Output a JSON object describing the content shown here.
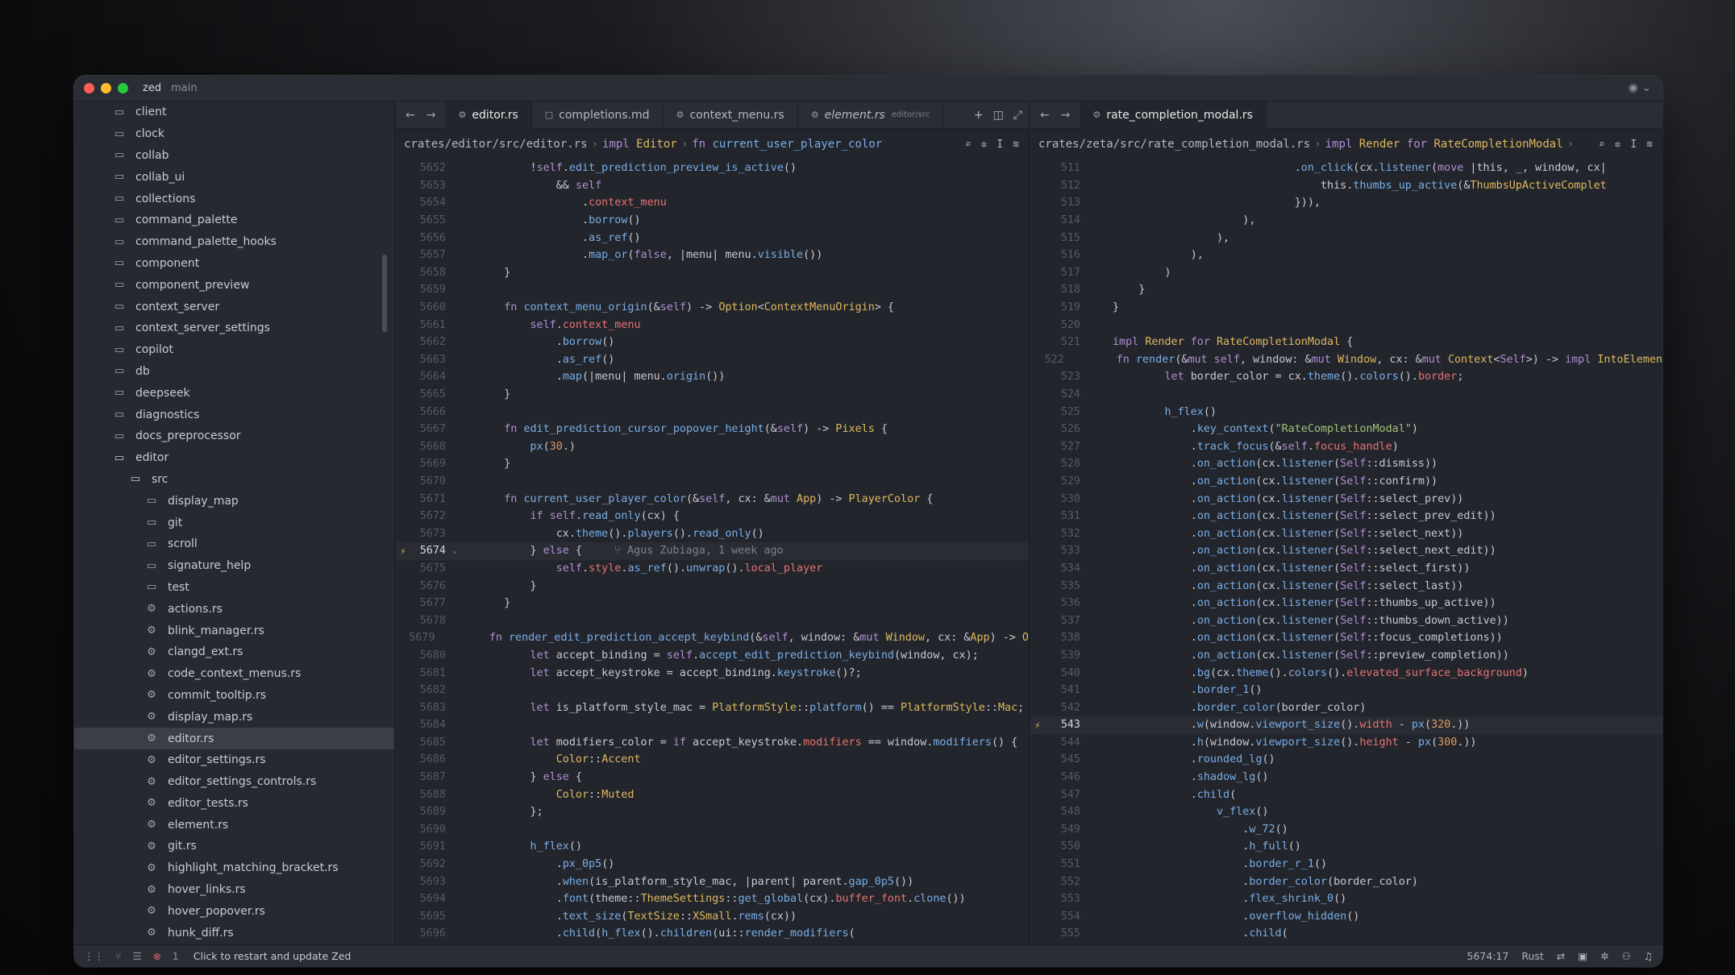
{
  "titlebar": {
    "app": "zed",
    "branch": "main"
  },
  "sidebar": {
    "items": [
      {
        "label": "client",
        "icon": "folder",
        "depth": 0
      },
      {
        "label": "clock",
        "icon": "folder",
        "depth": 0
      },
      {
        "label": "collab",
        "icon": "folder",
        "depth": 0
      },
      {
        "label": "collab_ui",
        "icon": "folder",
        "depth": 0
      },
      {
        "label": "collections",
        "icon": "folder",
        "depth": 0
      },
      {
        "label": "command_palette",
        "icon": "folder",
        "depth": 0
      },
      {
        "label": "command_palette_hooks",
        "icon": "folder",
        "depth": 0
      },
      {
        "label": "component",
        "icon": "folder",
        "depth": 0
      },
      {
        "label": "component_preview",
        "icon": "folder",
        "depth": 0
      },
      {
        "label": "context_server",
        "icon": "folder",
        "depth": 0
      },
      {
        "label": "context_server_settings",
        "icon": "folder",
        "depth": 0
      },
      {
        "label": "copilot",
        "icon": "folder",
        "depth": 0
      },
      {
        "label": "db",
        "icon": "folder",
        "depth": 0
      },
      {
        "label": "deepseek",
        "icon": "folder",
        "depth": 0
      },
      {
        "label": "diagnostics",
        "icon": "folder",
        "depth": 0
      },
      {
        "label": "docs_preprocessor",
        "icon": "folder",
        "depth": 0
      },
      {
        "label": "editor",
        "icon": "folder-open",
        "depth": 0
      },
      {
        "label": "src",
        "icon": "folder-open",
        "depth": 1
      },
      {
        "label": "display_map",
        "icon": "folder",
        "depth": 2
      },
      {
        "label": "git",
        "icon": "folder",
        "depth": 2
      },
      {
        "label": "scroll",
        "icon": "folder",
        "depth": 2
      },
      {
        "label": "signature_help",
        "icon": "folder",
        "depth": 2
      },
      {
        "label": "test",
        "icon": "folder",
        "depth": 2
      },
      {
        "label": "actions.rs",
        "icon": "rust-file",
        "depth": 2
      },
      {
        "label": "blink_manager.rs",
        "icon": "rust-file",
        "depth": 2
      },
      {
        "label": "clangd_ext.rs",
        "icon": "rust-file",
        "depth": 2
      },
      {
        "label": "code_context_menus.rs",
        "icon": "rust-file",
        "depth": 2
      },
      {
        "label": "commit_tooltip.rs",
        "icon": "rust-file",
        "depth": 2
      },
      {
        "label": "display_map.rs",
        "icon": "rust-file",
        "depth": 2
      },
      {
        "label": "editor.rs",
        "icon": "rust-file",
        "depth": 2,
        "selected": true
      },
      {
        "label": "editor_settings.rs",
        "icon": "rust-file",
        "depth": 2
      },
      {
        "label": "editor_settings_controls.rs",
        "icon": "rust-file",
        "depth": 2
      },
      {
        "label": "editor_tests.rs",
        "icon": "rust-file",
        "depth": 2
      },
      {
        "label": "element.rs",
        "icon": "rust-file",
        "depth": 2
      },
      {
        "label": "git.rs",
        "icon": "rust-file",
        "depth": 2
      },
      {
        "label": "highlight_matching_bracket.rs",
        "icon": "rust-file",
        "depth": 2
      },
      {
        "label": "hover_links.rs",
        "icon": "rust-file",
        "depth": 2
      },
      {
        "label": "hover_popover.rs",
        "icon": "rust-file",
        "depth": 2
      },
      {
        "label": "hunk_diff.rs",
        "icon": "rust-file",
        "depth": 2
      }
    ]
  },
  "left_pane": {
    "tabs": [
      {
        "label": "editor.rs",
        "active": true,
        "icon": "rust-file"
      },
      {
        "label": "completions.md",
        "icon": "markdown-file"
      },
      {
        "label": "context_menu.rs",
        "icon": "rust-file"
      },
      {
        "label": "element.rs",
        "detail": "editor/src",
        "icon": "rust-file",
        "italic": true
      }
    ],
    "breadcrumb": {
      "path": "crates/editor/src/editor.rs",
      "impl_kw": "impl",
      "impl_type": "Editor",
      "fn_kw": "fn",
      "fn_name": "current_user_player_color"
    },
    "current_line": 5674,
    "blame": "Agus Zubiaga, 1 week ago",
    "lines": [
      [
        5652,
        "        !self.edit_prediction_preview_is_active()"
      ],
      [
        5653,
        "            && self"
      ],
      [
        5654,
        "                .context_menu"
      ],
      [
        5655,
        "                .borrow()"
      ],
      [
        5656,
        "                .as_ref()"
      ],
      [
        5657,
        "                .map_or(false, |menu| menu.visible())"
      ],
      [
        5658,
        "    }"
      ],
      [
        5659,
        ""
      ],
      [
        5660,
        "    fn context_menu_origin(&self) -> Option<ContextMenuOrigin> {"
      ],
      [
        5661,
        "        self.context_menu"
      ],
      [
        5662,
        "            .borrow()"
      ],
      [
        5663,
        "            .as_ref()"
      ],
      [
        5664,
        "            .map(|menu| menu.origin())"
      ],
      [
        5665,
        "    }"
      ],
      [
        5666,
        ""
      ],
      [
        5667,
        "    fn edit_prediction_cursor_popover_height(&self) -> Pixels {"
      ],
      [
        5668,
        "        px(30.)"
      ],
      [
        5669,
        "    }"
      ],
      [
        5670,
        ""
      ],
      [
        5671,
        "    fn current_user_player_color(&self, cx: &mut App) -> PlayerColor {"
      ],
      [
        5672,
        "        if self.read_only(cx) {"
      ],
      [
        5673,
        "            cx.theme().players().read_only()"
      ],
      [
        5674,
        "        } else {"
      ],
      [
        5675,
        "            self.style.as_ref().unwrap().local_player"
      ],
      [
        5676,
        "        }"
      ],
      [
        5677,
        "    }"
      ],
      [
        5678,
        ""
      ],
      [
        5679,
        "    fn render_edit_prediction_accept_keybind(&self, window: &mut Window, cx: &App) -> O"
      ],
      [
        5680,
        "        let accept_binding = self.accept_edit_prediction_keybind(window, cx);"
      ],
      [
        5681,
        "        let accept_keystroke = accept_binding.keystroke()?;"
      ],
      [
        5682,
        ""
      ],
      [
        5683,
        "        let is_platform_style_mac = PlatformStyle::platform() == PlatformStyle::Mac;"
      ],
      [
        5684,
        ""
      ],
      [
        5685,
        "        let modifiers_color = if accept_keystroke.modifiers == window.modifiers() {"
      ],
      [
        5686,
        "            Color::Accent"
      ],
      [
        5687,
        "        } else {"
      ],
      [
        5688,
        "            Color::Muted"
      ],
      [
        5689,
        "        };"
      ],
      [
        5690,
        ""
      ],
      [
        5691,
        "        h_flex()"
      ],
      [
        5692,
        "            .px_0p5()"
      ],
      [
        5693,
        "            .when(is_platform_style_mac, |parent| parent.gap_0p5())"
      ],
      [
        5694,
        "            .font(theme::ThemeSettings::get_global(cx).buffer_font.clone())"
      ],
      [
        5695,
        "            .text_size(TextSize::XSmall.rems(cx))"
      ],
      [
        5696,
        "            .child(h_flex().children(ui::render_modifiers("
      ]
    ]
  },
  "right_pane": {
    "tabs": [
      {
        "label": "rate_completion_modal.rs",
        "active": true,
        "icon": "rust-file"
      }
    ],
    "breadcrumb": {
      "path": "crates/zeta/src/rate_completion_modal.rs",
      "impl_kw": "impl",
      "impl_type": "Render",
      "for_kw": "for",
      "for_type": "RateCompletionModal"
    },
    "current_line": 543,
    "lines": [
      [
        511,
        "                            .on_click(cx.listener(move |this, _, window, cx|"
      ],
      [
        512,
        "                                this.thumbs_up_active(&ThumbsUpActiveComplet"
      ],
      [
        513,
        "                            })),"
      ],
      [
        514,
        "                    ),"
      ],
      [
        515,
        "                ),"
      ],
      [
        516,
        "            ),"
      ],
      [
        517,
        "        )"
      ],
      [
        518,
        "    }"
      ],
      [
        519,
        "}"
      ],
      [
        520,
        ""
      ],
      [
        521,
        "impl Render for RateCompletionModal {"
      ],
      [
        522,
        "    fn render(&mut self, window: &mut Window, cx: &mut Context<Self>) -> impl IntoElemen"
      ],
      [
        523,
        "        let border_color = cx.theme().colors().border;"
      ],
      [
        524,
        ""
      ],
      [
        525,
        "        h_flex()"
      ],
      [
        526,
        "            .key_context(\"RateCompletionModal\")"
      ],
      [
        527,
        "            .track_focus(&self.focus_handle)"
      ],
      [
        528,
        "            .on_action(cx.listener(Self::dismiss))"
      ],
      [
        529,
        "            .on_action(cx.listener(Self::confirm))"
      ],
      [
        530,
        "            .on_action(cx.listener(Self::select_prev))"
      ],
      [
        531,
        "            .on_action(cx.listener(Self::select_prev_edit))"
      ],
      [
        532,
        "            .on_action(cx.listener(Self::select_next))"
      ],
      [
        533,
        "            .on_action(cx.listener(Self::select_next_edit))"
      ],
      [
        534,
        "            .on_action(cx.listener(Self::select_first))"
      ],
      [
        535,
        "            .on_action(cx.listener(Self::select_last))"
      ],
      [
        536,
        "            .on_action(cx.listener(Self::thumbs_up_active))"
      ],
      [
        537,
        "            .on_action(cx.listener(Self::thumbs_down_active))"
      ],
      [
        538,
        "            .on_action(cx.listener(Self::focus_completions))"
      ],
      [
        539,
        "            .on_action(cx.listener(Self::preview_completion))"
      ],
      [
        540,
        "            .bg(cx.theme().colors().elevated_surface_background)"
      ],
      [
        541,
        "            .border_1()"
      ],
      [
        542,
        "            .border_color(border_color)"
      ],
      [
        543,
        "            .w(window.viewport_size().width - px(320.))"
      ],
      [
        544,
        "            .h(window.viewport_size().height - px(300.))"
      ],
      [
        545,
        "            .rounded_lg()"
      ],
      [
        546,
        "            .shadow_lg()"
      ],
      [
        547,
        "            .child("
      ],
      [
        548,
        "                v_flex()"
      ],
      [
        549,
        "                    .w_72()"
      ],
      [
        550,
        "                    .h_full()"
      ],
      [
        551,
        "                    .border_r_1()"
      ],
      [
        552,
        "                    .border_color(border_color)"
      ],
      [
        553,
        "                    .flex_shrink_0()"
      ],
      [
        554,
        "                    .overflow_hidden()"
      ],
      [
        555,
        "                    .child("
      ]
    ]
  },
  "statusbar": {
    "error_count": "1",
    "message": "Click to restart and update Zed",
    "cursor": "5674:17",
    "language": "Rust"
  },
  "colors": {
    "keyword": "#b18fd6",
    "function": "#7aaee8",
    "type": "#e0b862",
    "string": "#a5c27a",
    "field": "#e57373",
    "number": "#e09a5c"
  }
}
